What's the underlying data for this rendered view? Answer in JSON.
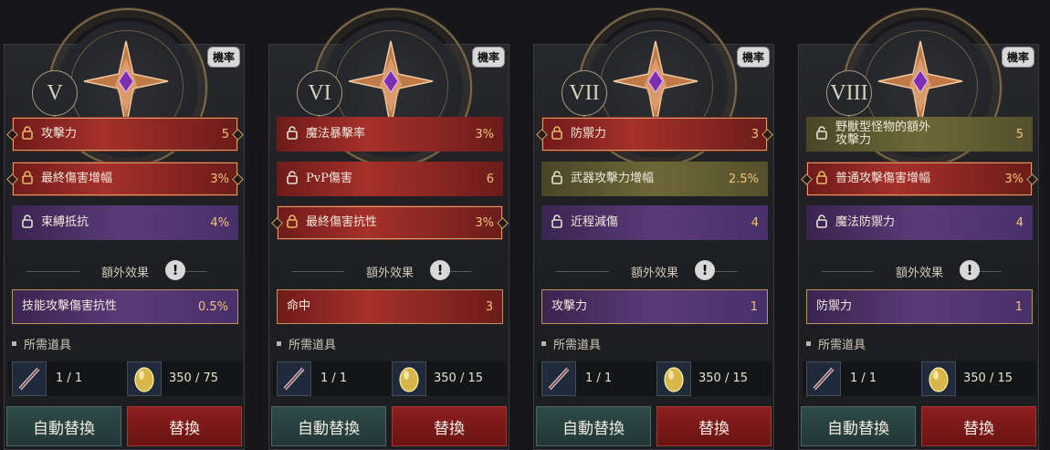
{
  "panels": [
    {
      "roman": "V",
      "probability": "機率",
      "stats": [
        {
          "label": "攻擊力",
          "value": "5",
          "color": "red",
          "framed": true,
          "locked": true
        },
        {
          "label": "最終傷害增幅",
          "value": "3%",
          "color": "red",
          "framed": true,
          "locked": true
        },
        {
          "label": "束縛抵抗",
          "value": "4%",
          "color": "purple",
          "framed": false,
          "locked": false
        }
      ],
      "extra_title": "額外效果",
      "extra": {
        "label": "技能攻擊傷害抗性",
        "value": "0.5%",
        "color": "purple"
      },
      "required_title": "所需道具",
      "item1_count": "1 / 1",
      "item2_count": "350 / 75",
      "auto_button": "自動替換",
      "swap_button": "替換"
    },
    {
      "roman": "VI",
      "probability": "機率",
      "stats": [
        {
          "label": "魔法暴擊率",
          "value": "3%",
          "color": "red",
          "framed": false,
          "locked": false
        },
        {
          "label": "PvP傷害",
          "value": "6",
          "color": "red",
          "framed": false,
          "locked": false
        },
        {
          "label": "最終傷害抗性",
          "value": "3%",
          "color": "red",
          "framed": true,
          "locked": true
        }
      ],
      "extra_title": "額外效果",
      "extra": {
        "label": "命中",
        "value": "3",
        "color": "red"
      },
      "required_title": "所需道具",
      "item1_count": "1 / 1",
      "item2_count": "350 / 15",
      "auto_button": "自動替換",
      "swap_button": "替換"
    },
    {
      "roman": "VII",
      "probability": "機率",
      "stats": [
        {
          "label": "防禦力",
          "value": "3",
          "color": "red",
          "framed": true,
          "locked": true
        },
        {
          "label": "武器攻擊力增幅",
          "value": "2.5%",
          "color": "olive",
          "framed": false,
          "locked": false
        },
        {
          "label": "近程減傷",
          "value": "4",
          "color": "purple",
          "framed": false,
          "locked": false
        }
      ],
      "extra_title": "額外效果",
      "extra": {
        "label": "攻擊力",
        "value": "1",
        "color": "purple"
      },
      "required_title": "所需道具",
      "item1_count": "1 / 1",
      "item2_count": "350 / 15",
      "auto_button": "自動替換",
      "swap_button": "替換"
    },
    {
      "roman": "VIII",
      "probability": "機率",
      "stats": [
        {
          "label": "野獸型怪物的額外\n攻擊力",
          "value": "5",
          "color": "olive",
          "framed": false,
          "locked": false
        },
        {
          "label": "普通攻擊傷害增幅",
          "value": "3%",
          "color": "red",
          "framed": true,
          "locked": true
        },
        {
          "label": "魔法防禦力",
          "value": "4",
          "color": "purple",
          "framed": false,
          "locked": false
        }
      ],
      "extra_title": "額外效果",
      "extra": {
        "label": "防禦力",
        "value": "1",
        "color": "purple"
      },
      "required_title": "所需道具",
      "item1_count": "1 / 1",
      "item2_count": "350 / 15",
      "auto_button": "自動替換",
      "swap_button": "替換"
    }
  ]
}
